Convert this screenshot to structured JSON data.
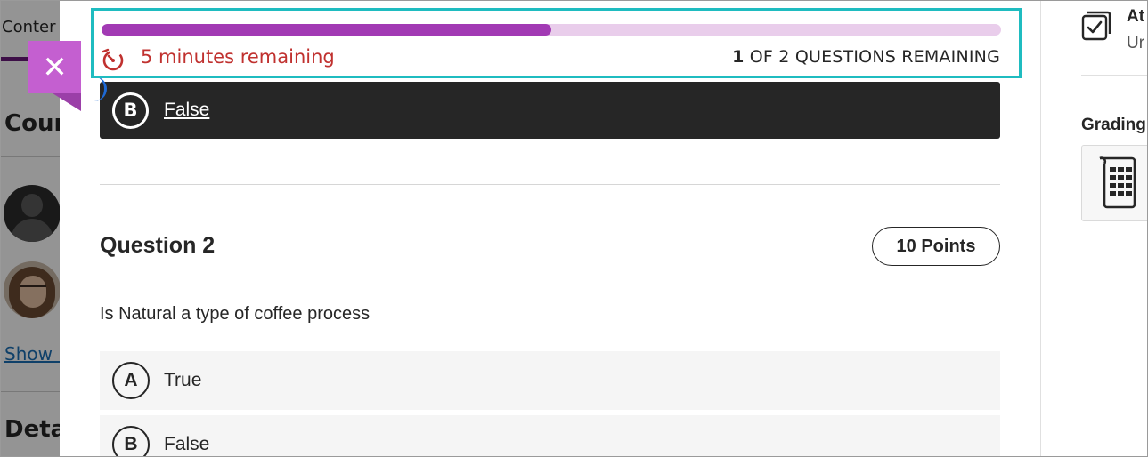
{
  "background": {
    "tab_label": "Conter",
    "heading": "Cour",
    "link": "Show r",
    "heading2": "Deta"
  },
  "header": {
    "progress_fraction": 0.5,
    "timer_text": "5 minutes remaining",
    "questions_count": "1",
    "questions_remaining_label": "OF 2 QUESTIONS REMAINING",
    "accent_color": "#a23ab4",
    "timer_color": "#c0312f",
    "highlight_color": "#1fbcc0"
  },
  "previous_question": {
    "selected_answer": {
      "letter": "B",
      "text": "False"
    }
  },
  "question": {
    "title": "Question 2",
    "points": "10 Points",
    "prompt": "Is Natural a type of coffee process",
    "options": [
      {
        "letter": "A",
        "text": "True"
      },
      {
        "letter": "B",
        "text": "False"
      }
    ]
  },
  "sidebar": {
    "attempt_title": "At",
    "attempt_sub": "Ur",
    "grading_title": "Grading"
  },
  "close": {
    "label": "✕"
  }
}
